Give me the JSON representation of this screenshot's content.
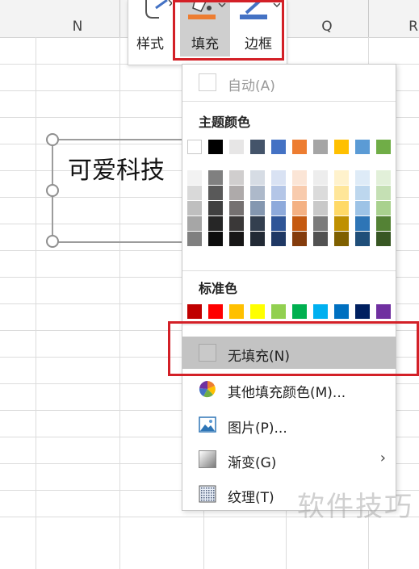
{
  "sheet": {
    "columns": [
      "N",
      "Q",
      "R"
    ],
    "textbox_text": "可爱科技"
  },
  "toolbar": {
    "style_label": "样式",
    "fill_label": "填充",
    "border_label": "边框",
    "fill_accent": "#ed7d31",
    "border_accent": "#4472c4",
    "highlight_color": "#d32027"
  },
  "menu": {
    "auto_label": "自动(A)",
    "theme_title": "主题颜色",
    "theme_colors": [
      "#ffffff",
      "#000000",
      "#e7e6e6",
      "#44546a",
      "#4472c4",
      "#ed7d31",
      "#a5a5a5",
      "#ffc000",
      "#5b9bd5",
      "#70ad47"
    ],
    "theme_shades": [
      [
        "#f2f2f2",
        "#d9d9d9",
        "#bfbfbf",
        "#a6a6a6",
        "#808080"
      ],
      [
        "#808080",
        "#595959",
        "#404040",
        "#262626",
        "#0d0d0d"
      ],
      [
        "#d0cece",
        "#aeaaaa",
        "#757171",
        "#3a3838",
        "#171616"
      ],
      [
        "#d6dce4",
        "#adb9ca",
        "#8497b0",
        "#333f4f",
        "#222a35"
      ],
      [
        "#d9e2f3",
        "#b4c6e7",
        "#8eaadb",
        "#2f5597",
        "#1f3864"
      ],
      [
        "#fbe5d6",
        "#f8cbad",
        "#f4b183",
        "#c55a11",
        "#843c0c"
      ],
      [
        "#ededed",
        "#dbdbdb",
        "#c9c9c9",
        "#7b7b7b",
        "#525252"
      ],
      [
        "#fff2cc",
        "#ffe699",
        "#ffd966",
        "#bf9000",
        "#7f6000"
      ],
      [
        "#deebf7",
        "#bdd7ee",
        "#9dc3e6",
        "#2e75b6",
        "#1f4e79"
      ],
      [
        "#e2f0d9",
        "#c5e0b4",
        "#a9d18e",
        "#548235",
        "#385723"
      ]
    ],
    "standard_title": "标准色",
    "standard_colors": [
      "#c00000",
      "#ff0000",
      "#ffc000",
      "#ffff00",
      "#92d050",
      "#00b050",
      "#00b0f0",
      "#0070c0",
      "#002060",
      "#7030a0"
    ],
    "no_fill_label": "无填充(N)",
    "more_colors_label": "其他填充颜色(M)...",
    "picture_label": "图片(P)...",
    "gradient_label": "渐变(G)",
    "texture_label": "纹理(T)"
  },
  "watermark": "软件技巧"
}
